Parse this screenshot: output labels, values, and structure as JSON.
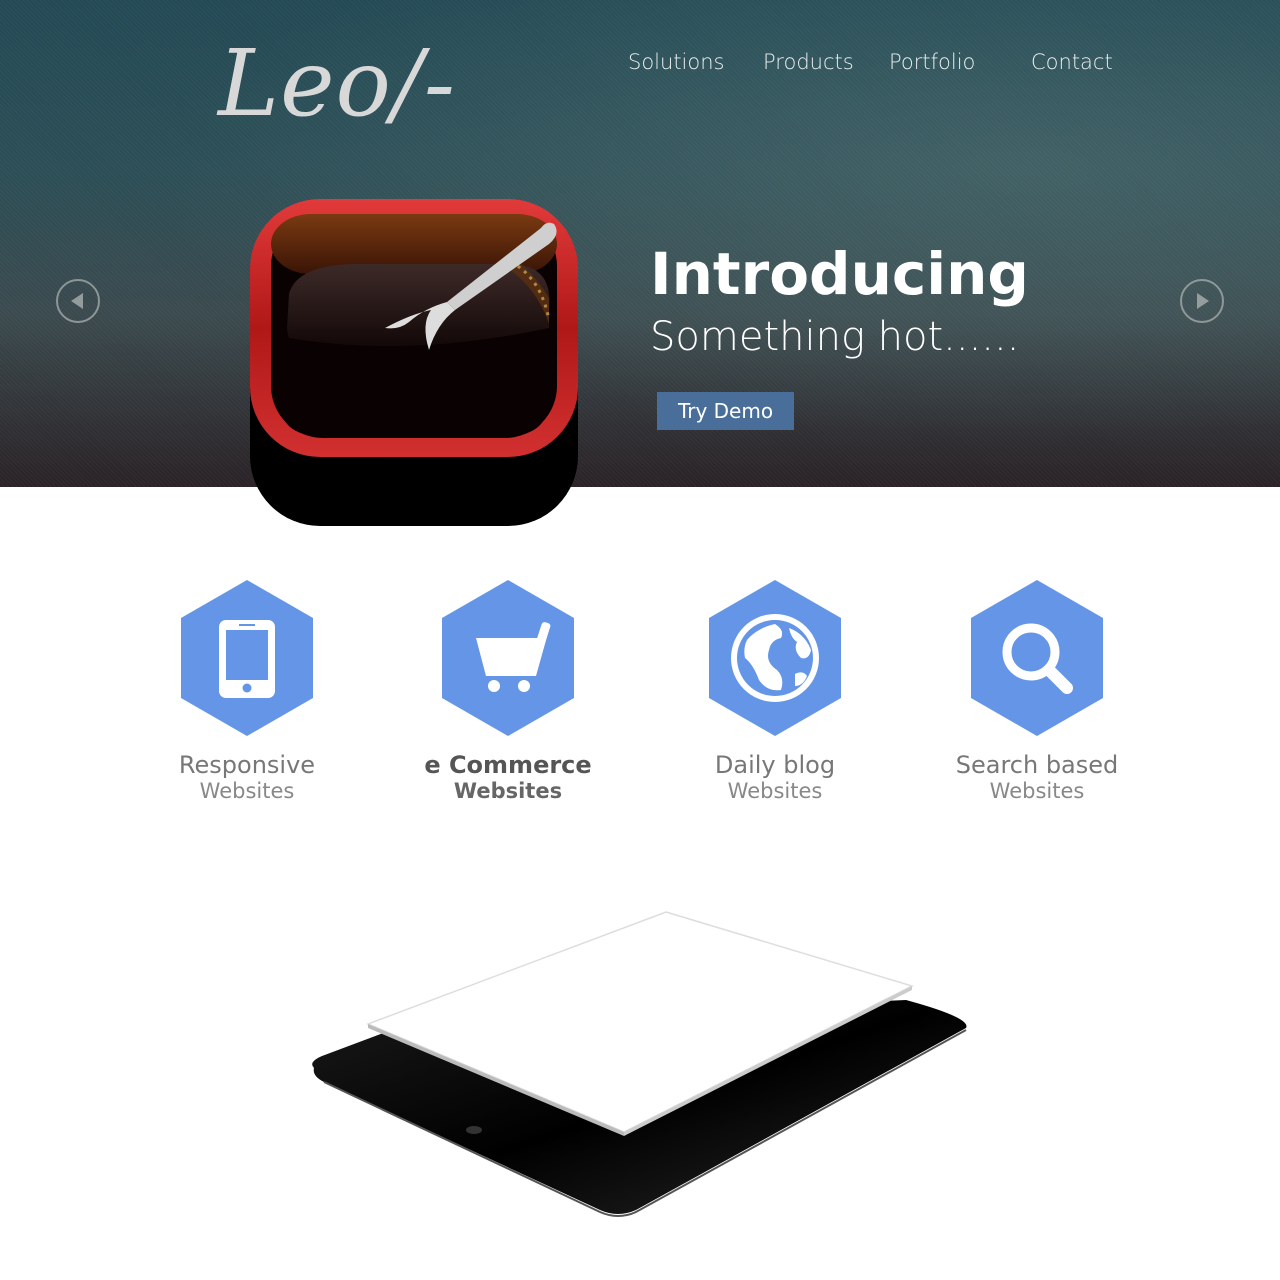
{
  "brand": {
    "logo_text": "Leo/-"
  },
  "nav": {
    "items": [
      {
        "label": "Solutions"
      },
      {
        "label": "Products"
      },
      {
        "label": "Portfolio"
      },
      {
        "label": "Contact"
      }
    ]
  },
  "hero": {
    "title": "Introducing",
    "subtitle": "Something hot......",
    "cta_label": "Try Demo",
    "icons": {
      "prev": "chevron-left-icon",
      "next": "chevron-right-icon",
      "app": "dessert-app-icon"
    }
  },
  "features": [
    {
      "title": "Responsive",
      "subtitle": "Websites",
      "icon": "tablet-icon",
      "emphasized": false
    },
    {
      "title": "e Commerce",
      "subtitle": "Websites",
      "icon": "cart-icon",
      "emphasized": true
    },
    {
      "title": "Daily blog",
      "subtitle": "Websites",
      "icon": "globe-icon",
      "emphasized": false
    },
    {
      "title": "Search based",
      "subtitle": "Websites",
      "icon": "search-icon",
      "emphasized": false
    }
  ],
  "colors": {
    "accent_blue": "#6495e6",
    "cta_blue": "#4a6e9a",
    "icon_frame_red": "#c42020",
    "hero_dark": "#2c4e56"
  }
}
